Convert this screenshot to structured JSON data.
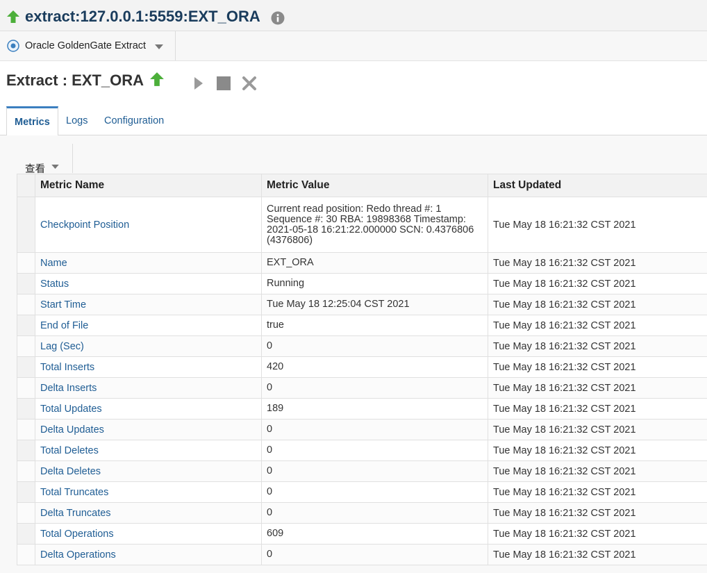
{
  "window": {
    "title": "extract:127.0.0.1:5559:EXT_ORA"
  },
  "target": {
    "label": "Oracle GoldenGate Extract"
  },
  "heading": {
    "title": "Extract : EXT_ORA"
  },
  "tabs": [
    {
      "label": "Metrics",
      "active": true
    },
    {
      "label": "Logs",
      "active": false
    },
    {
      "label": "Configuration",
      "active": false
    }
  ],
  "view_menu": {
    "label": "查看"
  },
  "table": {
    "columns": [
      "Metric Name",
      "Metric Value",
      "Last Updated"
    ],
    "rows": [
      {
        "name": "Checkpoint Position",
        "value": "Current read position: Redo thread #: 1 Sequence #: 30 RBA: 19898368 Timestamp: 2021-05-18 16:21:22.000000 SCN: 0.4376806 (4376806)",
        "updated": "Tue May 18 16:21:32 CST 2021"
      },
      {
        "name": "Name",
        "value": "EXT_ORA",
        "updated": "Tue May 18 16:21:32 CST 2021"
      },
      {
        "name": "Status",
        "value": "Running",
        "updated": "Tue May 18 16:21:32 CST 2021"
      },
      {
        "name": "Start Time",
        "value": "Tue May 18 12:25:04 CST 2021",
        "updated": "Tue May 18 16:21:32 CST 2021"
      },
      {
        "name": "End of File",
        "value": "true",
        "updated": "Tue May 18 16:21:32 CST 2021"
      },
      {
        "name": "Lag (Sec)",
        "value": "0",
        "updated": "Tue May 18 16:21:32 CST 2021"
      },
      {
        "name": "Total Inserts",
        "value": "420",
        "updated": "Tue May 18 16:21:32 CST 2021"
      },
      {
        "name": "Delta Inserts",
        "value": "0",
        "updated": "Tue May 18 16:21:32 CST 2021"
      },
      {
        "name": "Total Updates",
        "value": "189",
        "updated": "Tue May 18 16:21:32 CST 2021"
      },
      {
        "name": "Delta Updates",
        "value": "0",
        "updated": "Tue May 18 16:21:32 CST 2021"
      },
      {
        "name": "Total Deletes",
        "value": "0",
        "updated": "Tue May 18 16:21:32 CST 2021"
      },
      {
        "name": "Delta Deletes",
        "value": "0",
        "updated": "Tue May 18 16:21:32 CST 2021"
      },
      {
        "name": "Total Truncates",
        "value": "0",
        "updated": "Tue May 18 16:21:32 CST 2021"
      },
      {
        "name": "Delta Truncates",
        "value": "0",
        "updated": "Tue May 18 16:21:32 CST 2021"
      },
      {
        "name": "Total Operations",
        "value": "609",
        "updated": "Tue May 18 16:21:32 CST 2021"
      },
      {
        "name": "Delta Operations",
        "value": "0",
        "updated": "Tue May 18 16:21:32 CST 2021"
      }
    ]
  },
  "colors": {
    "title": "#1a3c5c",
    "link": "#1f5d94",
    "status_up": "#4caf3a"
  },
  "icons": {
    "title_status": "arrow-up-icon",
    "info": "info-icon",
    "target": "target-radio-icon",
    "start": "play-icon",
    "stop": "stop-icon",
    "kill": "close-icon"
  }
}
